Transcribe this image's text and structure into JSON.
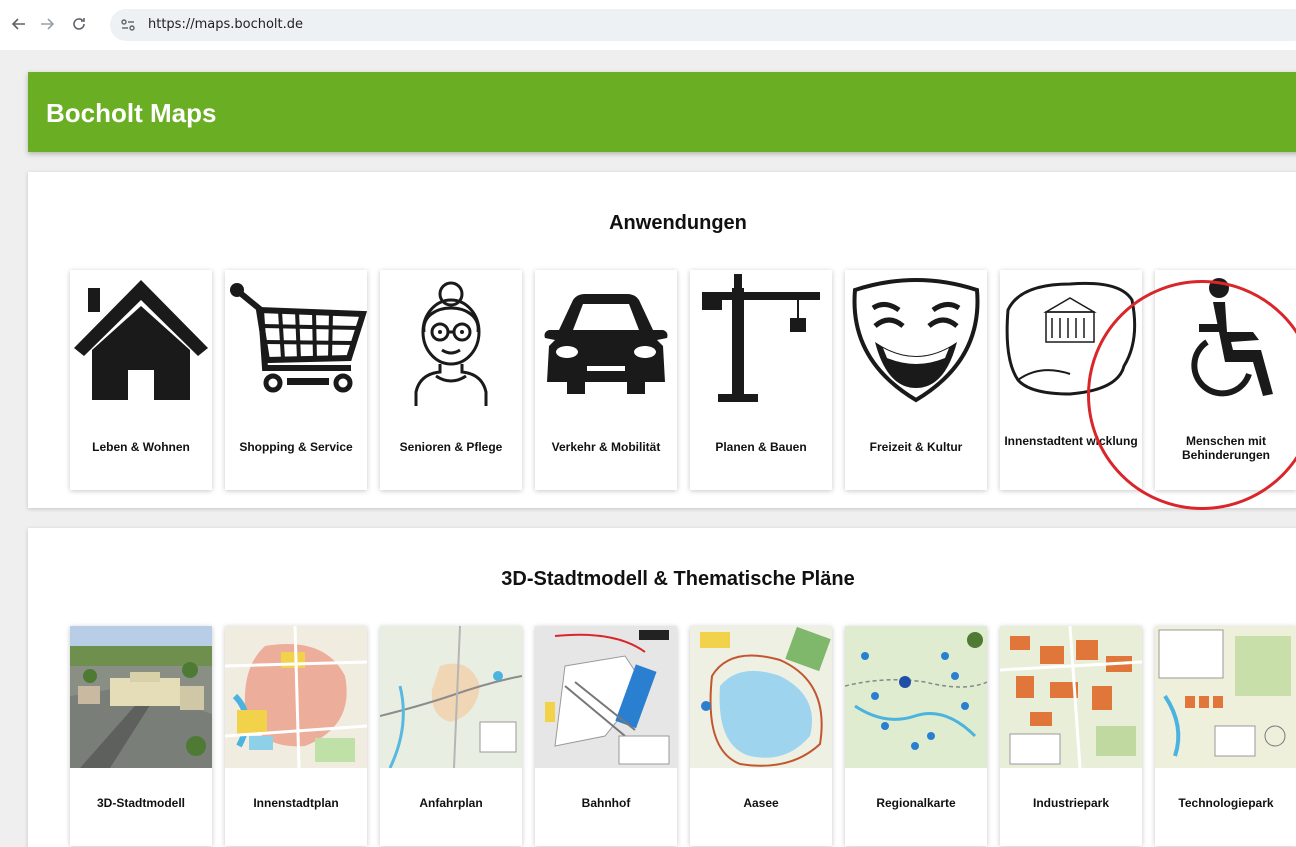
{
  "browser": {
    "url": "https://maps.bocholt.de"
  },
  "header": {
    "title": "Bocholt Maps",
    "color": "#6aae23"
  },
  "apps_section": {
    "title": "Anwendungen",
    "tiles": [
      {
        "label": "Leben & Wohnen",
        "icon": "house-icon"
      },
      {
        "label": "Shopping & Service",
        "icon": "shopping-cart-icon"
      },
      {
        "label": "Senioren & Pflege",
        "icon": "senior-woman-icon"
      },
      {
        "label": "Verkehr & Mobilität",
        "icon": "car-icon"
      },
      {
        "label": "Planen & Bauen",
        "icon": "construction-crane-icon"
      },
      {
        "label": "Freizeit & Kultur",
        "icon": "theater-mask-icon"
      },
      {
        "label": "Innenstadtent wicklung",
        "icon": "city-center-outline-icon"
      },
      {
        "label": "Menschen mit Behinderungen",
        "icon": "wheelchair-icon"
      }
    ]
  },
  "maps_section": {
    "title": "3D-Stadtmodell & Thematische Pläne",
    "tiles": [
      {
        "label": "3D-Stadtmodell"
      },
      {
        "label": "Innenstadtplan"
      },
      {
        "label": "Anfahrplan"
      },
      {
        "label": "Bahnhof"
      },
      {
        "label": "Aasee"
      },
      {
        "label": "Regionalkarte"
      },
      {
        "label": "Industriepark"
      },
      {
        "label": "Technologiepark"
      }
    ]
  },
  "highlight_color": "#d9262b"
}
